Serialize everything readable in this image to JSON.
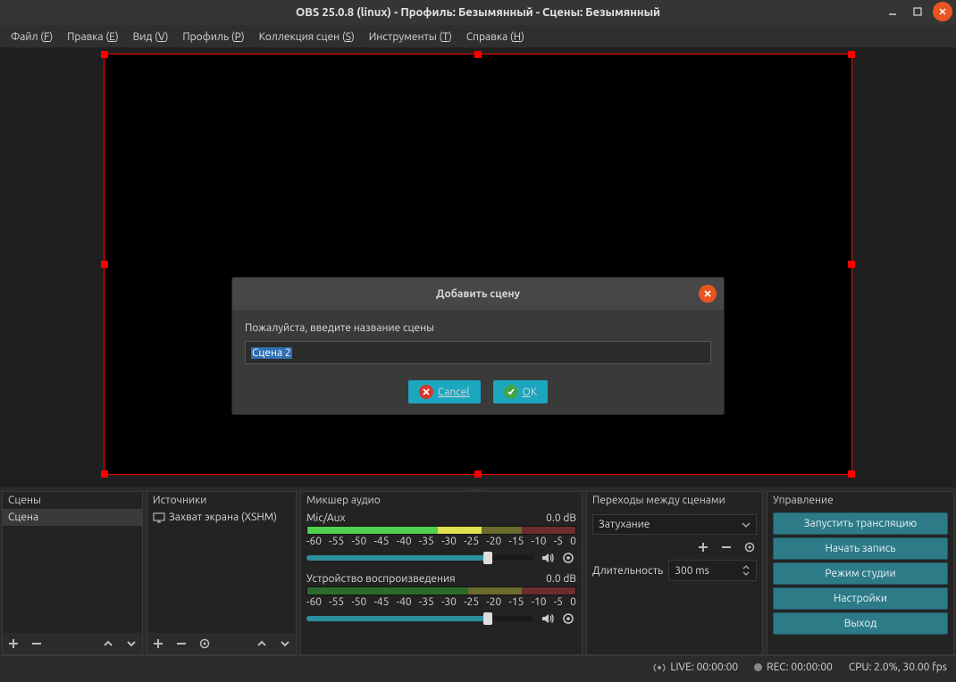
{
  "title": "OBS 25.0.8 (linux) - Профиль: Безымянный - Сцены: Безымянный",
  "menu": {
    "file": "Файл (",
    "file_u": "F",
    "file_e": ")",
    "edit": "Правка (",
    "edit_u": "E",
    "edit_e": ")",
    "view": "Вид (",
    "view_u": "V",
    "view_e": ")",
    "profile": "Профиль (",
    "profile_u": "P",
    "profile_e": ")",
    "scenes": "Коллекция сцен (",
    "scenes_u": "S",
    "scenes_e": ")",
    "tools": "Инструменты (",
    "tools_u": "T",
    "tools_e": ")",
    "help": "Справка (",
    "help_u": "H",
    "help_e": ")"
  },
  "scenes": {
    "header": "Сцены",
    "items": [
      "Сцена"
    ]
  },
  "sources": {
    "header": "Источники",
    "items": [
      "Захват экрана (XSHM)"
    ]
  },
  "mixer": {
    "header": "Микшер аудио",
    "channels": [
      {
        "name": "Mic/Aux",
        "db": "0.0 dB"
      },
      {
        "name": "Устройство воспроизведения",
        "db": "0.0 dB"
      }
    ],
    "ticks": [
      "-60",
      "-55",
      "-50",
      "-45",
      "-40",
      "-35",
      "-30",
      "-25",
      "-20",
      "-15",
      "-10",
      "-5",
      "0"
    ]
  },
  "transitions": {
    "header": "Переходы между сценами",
    "selected": "Затухание",
    "duration_label": "Длительность",
    "duration_value": "300 ms"
  },
  "controls": {
    "header": "Управление",
    "buttons": [
      "Запустить трансляцию",
      "Начать запись",
      "Режим студии",
      "Настройки",
      "Выход"
    ]
  },
  "status": {
    "live": "LIVE: 00:00:00",
    "rec": "REC: 00:00:00",
    "cpu": "CPU: 2.0%, 30.00 fps"
  },
  "dialog": {
    "title": "Добавить сцену",
    "prompt": "Пожалуйста, введите название сцены",
    "value": "Сцена 2",
    "cancel": "Cancel",
    "ok": "OK"
  }
}
